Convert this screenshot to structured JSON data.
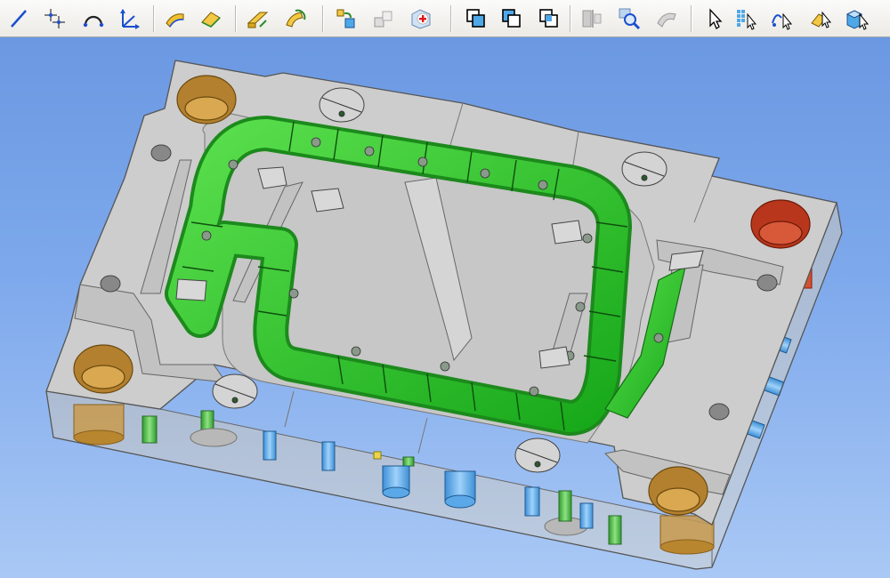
{
  "toolbar": {
    "buttons": [
      {
        "name": "line-tool-button",
        "icon": "line-icon"
      },
      {
        "name": "point-tool-button",
        "icon": "point-icon"
      },
      {
        "name": "arc-tool-button",
        "icon": "arc-icon"
      },
      {
        "name": "axis-tool-button",
        "icon": "axis-icon"
      },
      {
        "name": "sweep-surface-button",
        "icon": "sweep-icon"
      },
      {
        "name": "patch-surface-button",
        "icon": "patch-icon"
      },
      {
        "name": "extrude-button",
        "icon": "extrude-icon"
      },
      {
        "name": "revolve-button",
        "icon": "revolve-icon"
      },
      {
        "name": "assembly-button",
        "icon": "assembly-icon"
      },
      {
        "name": "blocks-button",
        "icon": "blocks-icon"
      },
      {
        "name": "repair-button",
        "icon": "repair-icon"
      },
      {
        "name": "union-button",
        "icon": "union-icon"
      },
      {
        "name": "subtract-button",
        "icon": "subtract-icon"
      },
      {
        "name": "intersect-button",
        "icon": "intersect-icon"
      },
      {
        "name": "section-button",
        "icon": "section-icon"
      },
      {
        "name": "zoom-inspect-button",
        "icon": "magnifier-icon"
      },
      {
        "name": "shell-button",
        "icon": "shell-icon"
      },
      {
        "name": "select-button",
        "icon": "cursor-icon"
      },
      {
        "name": "select-grid-button",
        "icon": "grid-select-icon"
      },
      {
        "name": "select-curves-button",
        "icon": "curve-select-icon"
      },
      {
        "name": "select-faces-button",
        "icon": "face-select-icon"
      },
      {
        "name": "select-solid-button",
        "icon": "solid-select-icon"
      }
    ]
  },
  "colors": {
    "background_top": "#6b98e2",
    "background_bottom": "#a9c8f5",
    "plate": "#c8c8c8",
    "plate_top": "#cfcfcf",
    "channel": "#22c425",
    "bushing_brown": "#a8782d",
    "bushing_red": "#b8361c",
    "pin_blue": "#5ba8e8",
    "pin_green": "#3aaa34"
  }
}
